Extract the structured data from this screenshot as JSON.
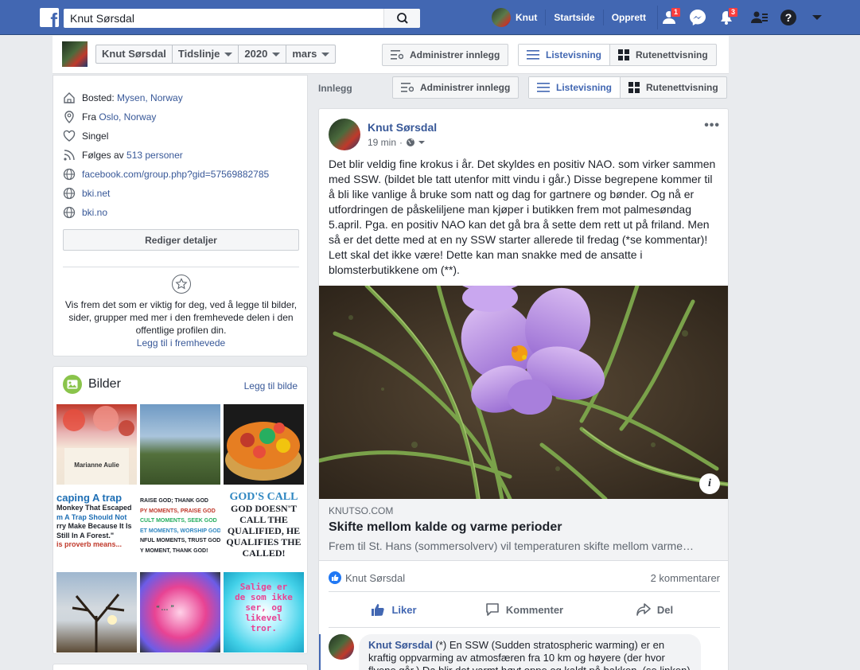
{
  "topbar": {
    "search_value": "Knut Sørsdal",
    "user_name": "Knut",
    "links": [
      "Startside",
      "Opprett"
    ],
    "badges": {
      "friends": "1",
      "notifications": "3"
    }
  },
  "subheader": {
    "crumbs": [
      "Knut Sørsdal",
      "Tidslinje",
      "2020",
      "mars"
    ],
    "manage_label": "Administrer innlegg",
    "list_view": "Listevisning",
    "grid_view": "Rutenettvisning"
  },
  "intro": {
    "rows": [
      {
        "icon": "home-icon",
        "prefix": "Bosted: ",
        "link": "Mysen, Norway"
      },
      {
        "icon": "location-pin-icon",
        "prefix": "Fra ",
        "link": "Oslo, Norway"
      },
      {
        "icon": "heart-icon",
        "prefix": "Singel",
        "link": ""
      },
      {
        "icon": "rss-icon",
        "prefix": "Følges av ",
        "link": "513 personer"
      },
      {
        "icon": "globe-icon",
        "prefix": "",
        "link": "facebook.com/group.php?gid=57569882785"
      },
      {
        "icon": "globe-icon",
        "prefix": "",
        "link": "bki.net"
      },
      {
        "icon": "globe-icon",
        "prefix": "",
        "link": "bki.no"
      }
    ],
    "edit_label": "Rediger detaljer",
    "feature_text": "Vis frem det som er viktig for deg, ved å legge til bilder, sider, grupper med mer i den fremhevede delen i den offentlige profilen din.",
    "feature_link": "Legg til i fremhevede"
  },
  "photos": {
    "title": "Bilder",
    "add_label": "Legg til bilde",
    "thumb_texts": {
      "t1": "Marianne Aulie",
      "t4_lines": [
        "caping A trap",
        "Monkey That Escaped",
        "m A Trap Should Not",
        "rry Make Because It Is",
        "Still In A Forest.\"",
        "is proverb means..."
      ],
      "t5_lines": [
        "RAISE GOD; THANK GOD",
        "PY MOMENTS, PRAISE GOD",
        "CULT MOMENTS, SEEK GOD",
        "ET MOMENTS, WORSHIP GOD",
        "NFUL MOMENTS, TRUST GOD",
        "Y MOMENT, THANK GOD!"
      ],
      "t6_lines": [
        "GOD'S CALL",
        "GOD DOESN'T",
        "CALL THE",
        "QUALIFIED, HE",
        "QUALIFIES THE",
        "CALLED!"
      ],
      "t9_lines": [
        "Salige er",
        "de som ikke",
        "ser, og",
        "likevel",
        "tror."
      ]
    }
  },
  "feed": {
    "label": "Innlegg",
    "post": {
      "author": "Knut Sørsdal",
      "time": "19 min",
      "text": "Det blir veldig fine krokus i år. Det skyldes en positiv NAO. som virker sammen med SSW. (bildet ble tatt utenfor mitt vindu i går.) Disse begrepene kommer til å bli like vanlige å bruke som natt og dag for gartnere og bønder. Og nå er utfordringen de påskeliljene man kjøper i butikken frem mot palmesøndag 5.april. Pga. en positiv NAO kan det gå bra å sette dem rett ut på friland. Men så er det dette med at en ny SSW starter allerede til fredag (*se kommentar)! Lett skal det ikke være! Dette kan man snakke med de ansatte i blomsterbutikkene om (**).",
      "link_domain": "KNUTSO.COM",
      "link_title": "Skifte mellom kalde og varme perioder",
      "link_desc": "Frem til St. Hans (sommersolverv) vil temperaturen skifte mellom varme…",
      "reaction_name": "Knut Sørsdal",
      "comments_count": "2 kommentarer",
      "actions": [
        "Liker",
        "Kommenter",
        "Del"
      ],
      "comment_author": "Knut Sørsdal",
      "comment_text": " (*) En SSW (Sudden stratospheric warming) er en kraftig oppvarming av atmosfæren fra 10 km og høyere (der hvor flyene går.) Da blir det varmt høyt oppe og kaldt på bakken. (se linken)"
    }
  },
  "colors": {
    "brand": "#4267b2",
    "link": "#385898",
    "badge": "#fa3e3e"
  }
}
